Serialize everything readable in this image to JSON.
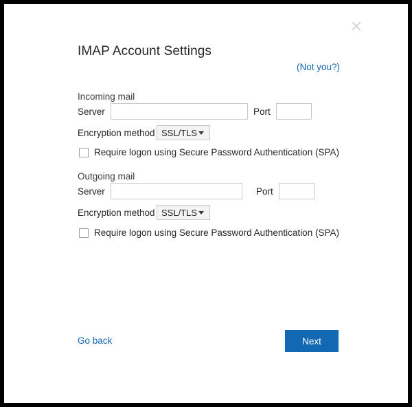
{
  "dialog": {
    "title": "IMAP Account Settings",
    "not_you_link": "(Not you?)",
    "close_icon": "close-icon"
  },
  "incoming": {
    "section_label": "Incoming mail",
    "server_label": "Server",
    "server_value": "",
    "port_label": "Port",
    "port_value": "",
    "encryption_label": "Encryption method",
    "encryption_value": "SSL/TLS",
    "spa_label": "Require logon using Secure Password Authentication (SPA)",
    "spa_checked": false
  },
  "outgoing": {
    "section_label": "Outgoing mail",
    "server_label": "Server",
    "server_value": "",
    "port_label": "Port",
    "port_value": "",
    "encryption_label": "Encryption method",
    "encryption_value": "SSL/TLS",
    "spa_label": "Require logon using Secure Password Authentication (SPA)",
    "spa_checked": false
  },
  "footer": {
    "go_back_label": "Go back",
    "next_label": "Next"
  },
  "colors": {
    "accent_blue": "#1268b3",
    "link_blue": "#1266b5",
    "text": "#262626",
    "border": "#c8c8c8",
    "frame": "#000000"
  }
}
